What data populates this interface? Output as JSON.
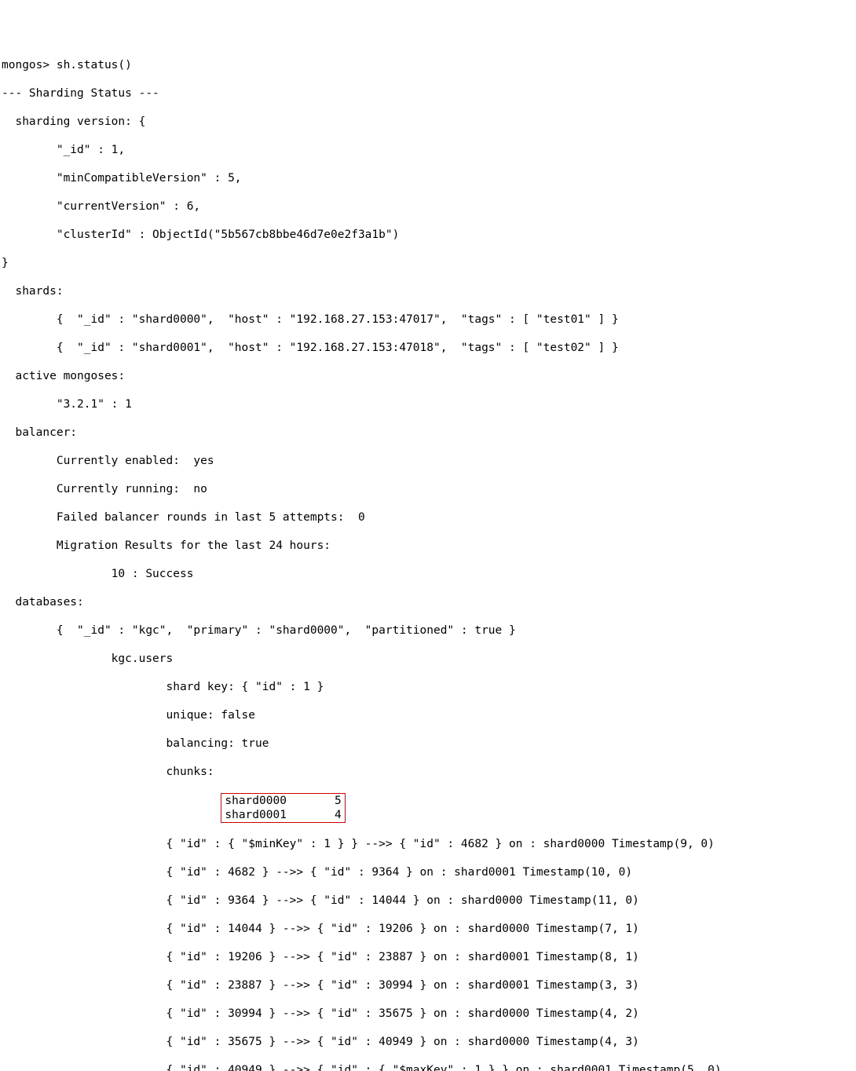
{
  "prompt": "mongos> sh.status()",
  "heading": "--- Sharding Status ---",
  "sharding_version_label": "  sharding version: {",
  "sv_id": "        \"_id\" : 1,",
  "sv_min": "        \"minCompatibleVersion\" : 5,",
  "sv_cur": "        \"currentVersion\" : 6,",
  "sv_cluster": "        \"clusterId\" : ObjectId(\"5b567cb8bbe46d7e0e2f3a1b\")",
  "sv_close": "}",
  "shards_label": "  shards:",
  "shard0": "        {  \"_id\" : \"shard0000\",  \"host\" : \"192.168.27.153:47017\",  \"tags\" : [ \"test01\" ] }",
  "shard1": "        {  \"_id\" : \"shard0001\",  \"host\" : \"192.168.27.153:47018\",  \"tags\" : [ \"test02\" ] }",
  "active_label": "  active mongoses:",
  "active_v": "        \"3.2.1\" : 1",
  "balancer_label": "  balancer:",
  "bal_enabled": "        Currently enabled:  yes",
  "bal_running": "        Currently running:  no",
  "bal_failed": "        Failed balancer rounds in last 5 attempts:  0",
  "bal_migr": "        Migration Results for the last 24 hours:",
  "bal_succ": "                10 : Success",
  "db_label": "  databases:",
  "db_kgc": "        {  \"_id\" : \"kgc\",  \"primary\" : \"shard0000\",  \"partitioned\" : true }",
  "coll": "                kgc.users",
  "coll_key": "                        shard key: { \"id\" : 1 }",
  "coll_uniq": "                        unique: false",
  "coll_bal": "                        balancing: true",
  "coll_chunks": "                        chunks:",
  "box_prefix": "                                ",
  "box_l1": "shard0000       5",
  "box_l2": "shard0001       4",
  "c0": "                        { \"id\" : { \"$minKey\" : 1 } } -->> { \"id\" : 4682 } on : shard0000 Timestamp(9, 0)",
  "c1": "                        { \"id\" : 4682 } -->> { \"id\" : 9364 } on : shard0001 Timestamp(10, 0)",
  "c2": "                        { \"id\" : 9364 } -->> { \"id\" : 14044 } on : shard0000 Timestamp(11, 0)",
  "c3": "                        { \"id\" : 14044 } -->> { \"id\" : 19206 } on : shard0000 Timestamp(7, 1)",
  "c4": "                        { \"id\" : 19206 } -->> { \"id\" : 23887 } on : shard0001 Timestamp(8, 1)",
  "c5": "                        { \"id\" : 23887 } -->> { \"id\" : 30994 } on : shard0001 Timestamp(3, 3)",
  "c6": "                        { \"id\" : 30994 } -->> { \"id\" : 35675 } on : shard0000 Timestamp(4, 2)",
  "c7": "                        { \"id\" : 35675 } -->> { \"id\" : 40949 } on : shard0000 Timestamp(4, 3)",
  "c8": "                        { \"id\" : 40949 } -->> { \"id\" : { \"$maxKey\" : 1 } } on : shard0001 Timestamp(5, 0)"
}
